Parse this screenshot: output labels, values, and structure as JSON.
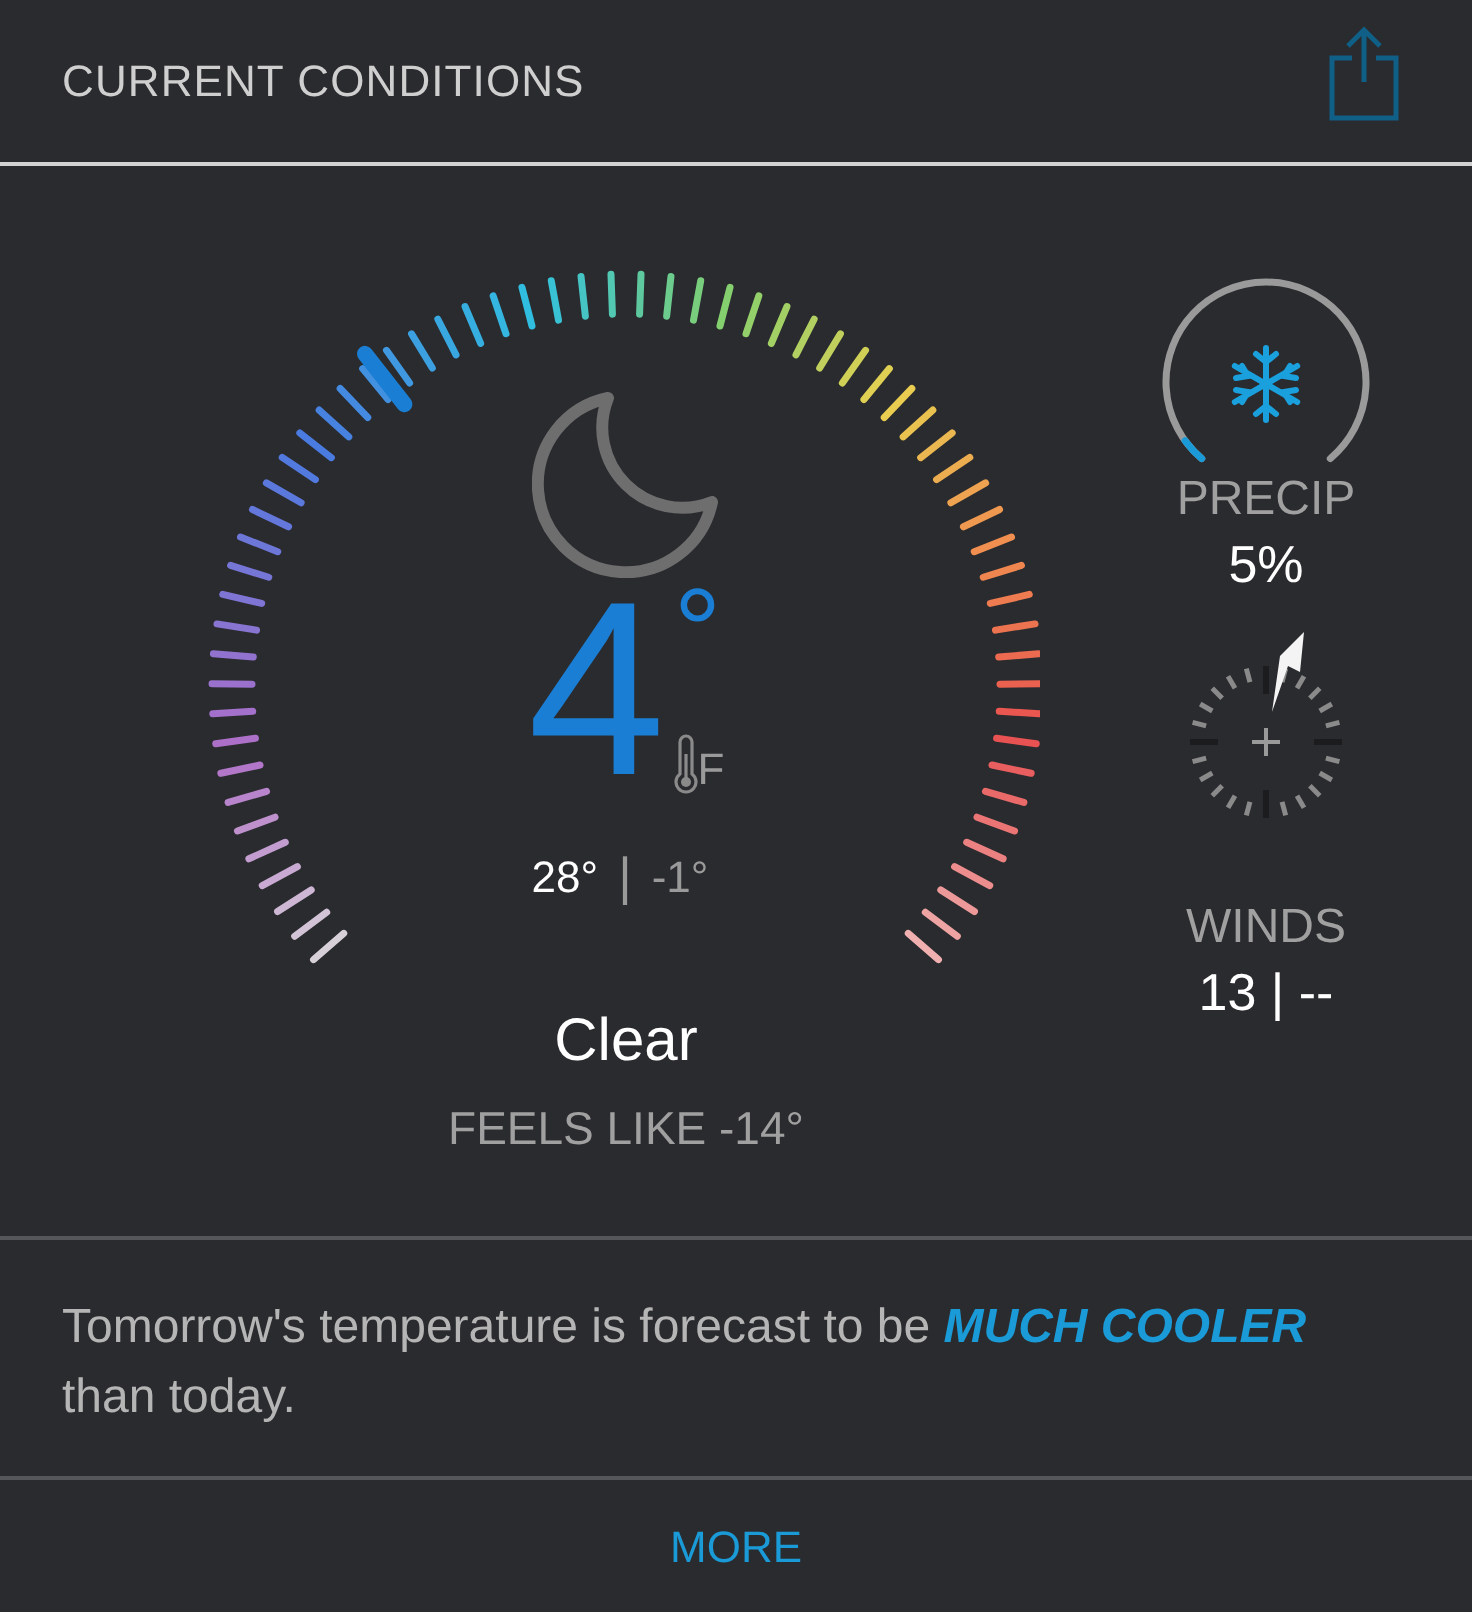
{
  "header": {
    "title": "CURRENT CONDITIONS"
  },
  "conditions": {
    "temperature": "4",
    "degree_sign": "°",
    "unit": "F",
    "high": "28°",
    "separator": "|",
    "low": "-1°",
    "condition": "Clear",
    "feels_like": "FEELS LIKE -14°"
  },
  "precip": {
    "label": "PRECIP",
    "value": "5%"
  },
  "winds": {
    "label": "WINDS",
    "value": "13 | --"
  },
  "forecast": {
    "text": "Tomorrow's temperature is forecast to be *MUCH COOLER* than today."
  },
  "more_button": {
    "label": "MORE"
  }
}
